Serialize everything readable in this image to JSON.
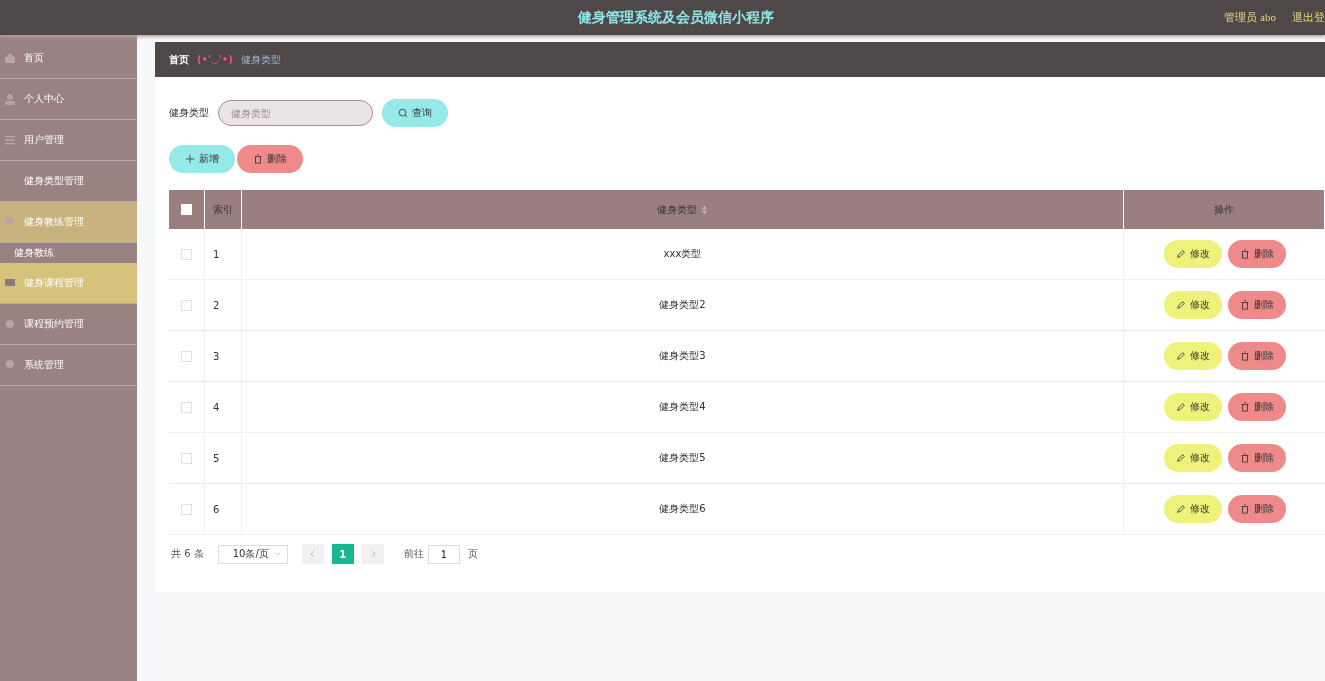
{
  "header": {
    "title": "健身管理系统及会员微信小程序",
    "user": "管理员 abo",
    "logout": "退出登"
  },
  "sidebar": {
    "items": [
      {
        "label": "首页",
        "highlighted": false,
        "kind": "menu"
      },
      {
        "label": "个人中心",
        "highlighted": false,
        "kind": "menu"
      },
      {
        "label": "用户管理",
        "highlighted": false,
        "kind": "menu"
      },
      {
        "label": "健身类型管理",
        "highlighted": false,
        "kind": "menu"
      },
      {
        "label": "健身教练管理",
        "highlighted": true,
        "kind": "menu"
      },
      {
        "label": "健身教练",
        "highlighted": false,
        "kind": "sub"
      },
      {
        "label": "健身课程管理",
        "highlighted": true,
        "kind": "menu"
      },
      {
        "label": "课程预约管理",
        "highlighted": false,
        "kind": "menu"
      },
      {
        "label": "系统管理",
        "highlighted": false,
        "kind": "menu"
      }
    ]
  },
  "breadcrumb": {
    "home": "首页",
    "separator": "(•'◡'•)",
    "current": "健身类型"
  },
  "search": {
    "label": "健身类型",
    "placeholder": "健身类型",
    "button": "查询"
  },
  "actions": {
    "add": "新增",
    "delete": "删除"
  },
  "table": {
    "columns": [
      "索引",
      "健身类型",
      "操作"
    ],
    "all_checked": false,
    "rows": [
      {
        "index": "1",
        "type": "xxx类型",
        "checked": false,
        "edit": "修改",
        "delete": "删除"
      },
      {
        "index": "2",
        "type": "健身类型2",
        "checked": false,
        "edit": "修改",
        "delete": "删除"
      },
      {
        "index": "3",
        "type": "健身类型3",
        "checked": false,
        "edit": "修改",
        "delete": "删除"
      },
      {
        "index": "4",
        "type": "健身类型4",
        "checked": false,
        "edit": "修改",
        "delete": "删除"
      },
      {
        "index": "5",
        "type": "健身类型5",
        "checked": false,
        "edit": "修改",
        "delete": "删除"
      },
      {
        "index": "6",
        "type": "健身类型6",
        "checked": false,
        "edit": "修改",
        "delete": "删除"
      }
    ]
  },
  "pagination": {
    "total": "共 6 条",
    "page_size": "10条/页",
    "pages": [
      {
        "label": "1",
        "selected": true
      }
    ],
    "goto": "前往",
    "goto_value": "1",
    "page_unit": "页"
  }
}
